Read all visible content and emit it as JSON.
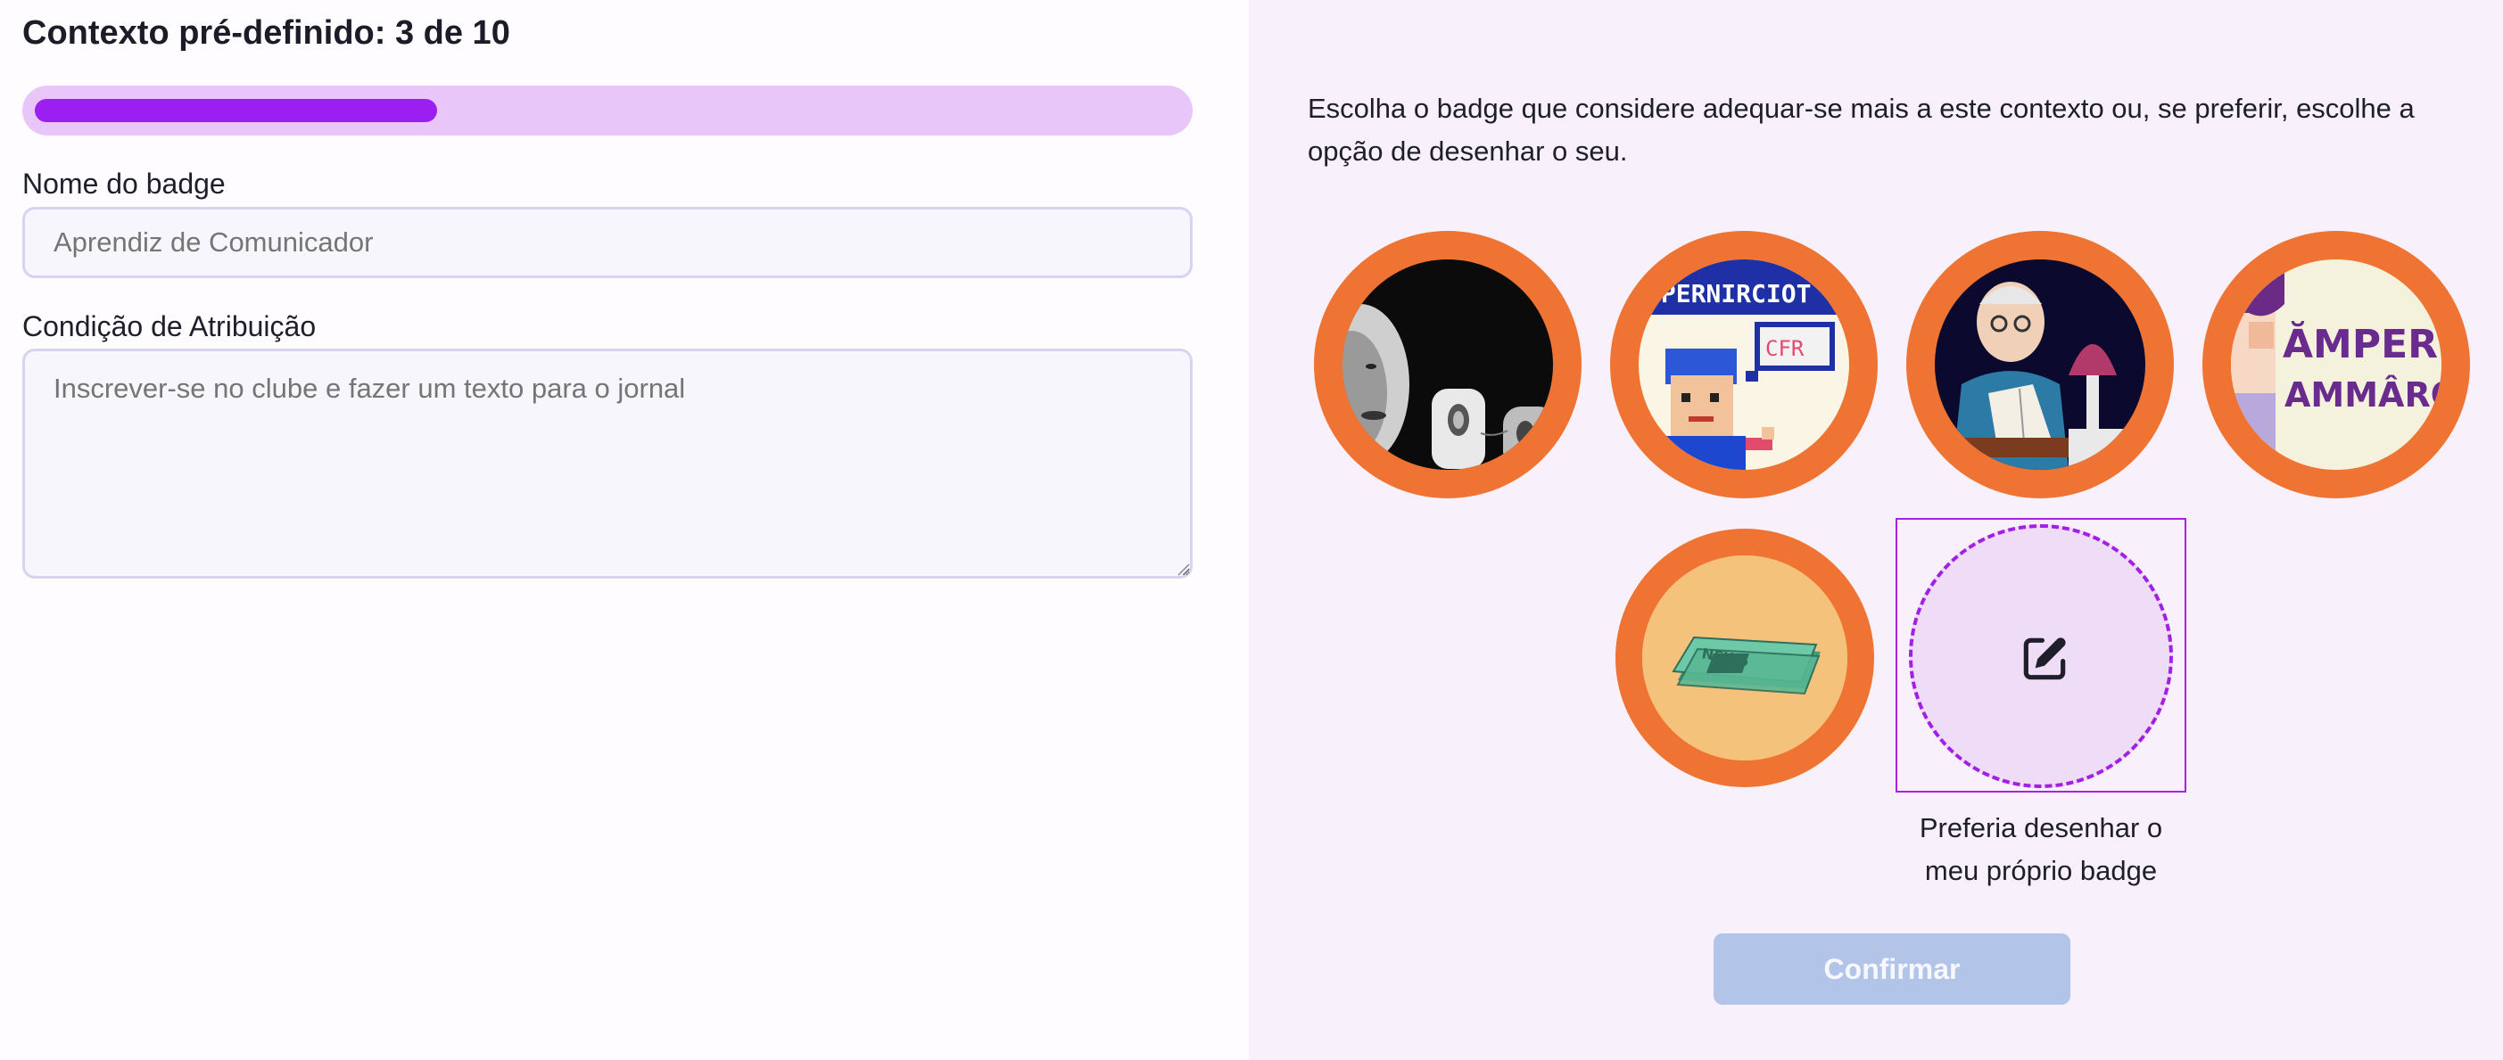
{
  "header": {
    "title": "Contexto pré-definido: 3 de 10"
  },
  "progress": {
    "current": 3,
    "total": 10,
    "fraction": 0.3
  },
  "form": {
    "name_label": "Nome do badge",
    "name_placeholder": "Aprendiz de Comunicador",
    "condition_label": "Condição de Atribuição",
    "condition_placeholder": "Inscrever-se no clube e fazer um texto para o jornal"
  },
  "chooser": {
    "intro": "Escolha o badge que considere adequar-se mais a este contexto ou, se preferir, escolhe a opção de desenhar o seu.",
    "badges": [
      {
        "name": "badge-masks",
        "art_text": ""
      },
      {
        "name": "badge-pixel-comic",
        "art_text": "UPERNIRCIOT",
        "bubble_text": "CFR"
      },
      {
        "name": "badge-reader",
        "art_text": ""
      },
      {
        "name": "badge-poster",
        "art_text_1": "ĂMPERI",
        "art_text_2": "AMMÂRO"
      },
      {
        "name": "badge-newspaper",
        "art_text": "NEWS"
      }
    ],
    "draw_own_label": "Preferia desenhar o meu próprio badge",
    "draw_icon": "edit-icon",
    "confirm_label": "Confirmar"
  },
  "colors": {
    "accent": "#9b1ff0",
    "badge_ring": "#ef7433",
    "confirm_disabled": "#b2c5e9"
  }
}
